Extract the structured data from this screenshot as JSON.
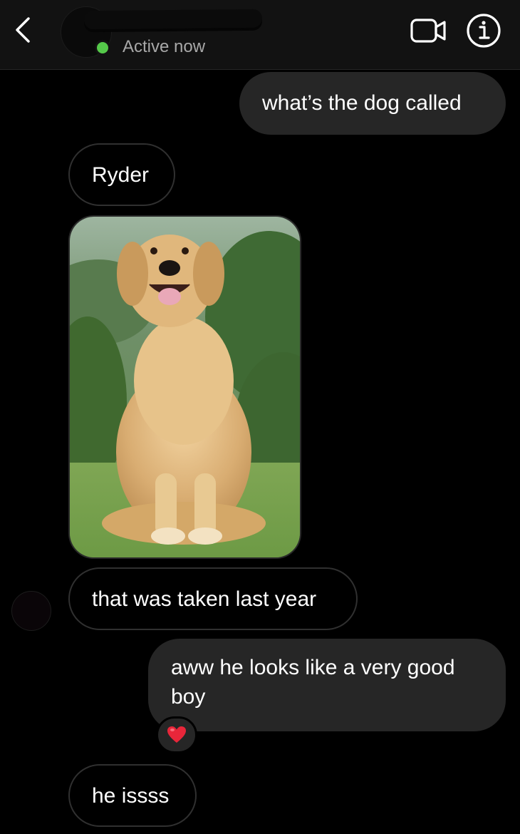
{
  "header": {
    "status": "Active now",
    "icons": {
      "back": "chevron-left-icon",
      "video": "video-camera-icon",
      "info": "info-icon"
    },
    "status_color": "#55c94a"
  },
  "messages": [
    {
      "id": 1,
      "direction": "outgoing",
      "text": "what’s the dog called"
    },
    {
      "id": 2,
      "direction": "incoming",
      "text": "Ryder"
    },
    {
      "id": 3,
      "direction": "incoming",
      "type": "photo",
      "subject": "golden retriever sitting on grass"
    },
    {
      "id": 4,
      "direction": "incoming",
      "text": "that was taken last year"
    },
    {
      "id": 5,
      "direction": "outgoing",
      "text": "aww he looks like a very good boy",
      "reaction": "heart-emoji"
    },
    {
      "id": 6,
      "direction": "incoming",
      "text": "he issss"
    }
  ],
  "colors": {
    "background": "#000000",
    "outgoing_bubble": "#262626",
    "incoming_border": "#303030"
  }
}
